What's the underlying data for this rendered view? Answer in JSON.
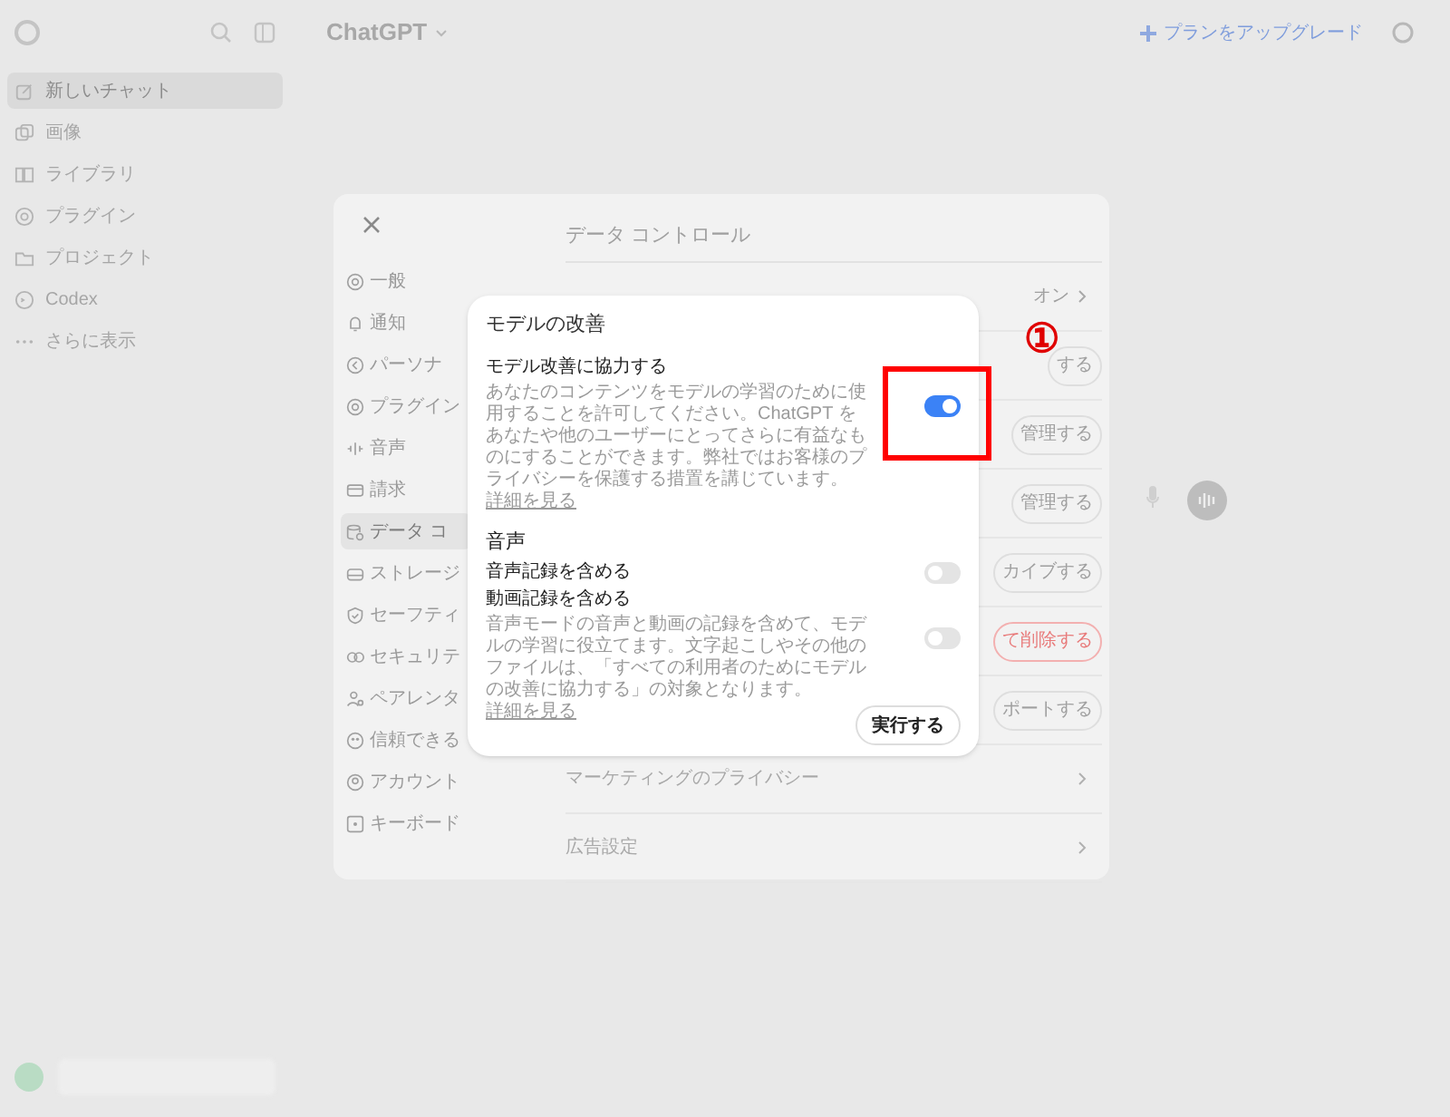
{
  "topbar": {
    "title": "ChatGPT",
    "upgrade": "プランをアップグレード"
  },
  "sidebar": {
    "items": [
      {
        "label": "新しいチャット",
        "selected": true
      },
      {
        "label": "画像",
        "selected": false
      },
      {
        "label": "ライブラリ",
        "selected": false
      },
      {
        "label": "プラグイン",
        "selected": false
      },
      {
        "label": "プロジェクト",
        "selected": false
      },
      {
        "label": "Codex",
        "selected": false
      },
      {
        "label": "さらに表示",
        "selected": false
      }
    ]
  },
  "settings": {
    "nav": [
      {
        "label": "一般",
        "selected": false
      },
      {
        "label": "通知",
        "selected": false
      },
      {
        "label": "パーソナ",
        "selected": false
      },
      {
        "label": "プラグイン",
        "selected": false
      },
      {
        "label": "音声",
        "selected": false
      },
      {
        "label": "請求",
        "selected": false
      },
      {
        "label": "データ コ",
        "selected": true
      },
      {
        "label": "ストレージ",
        "selected": false
      },
      {
        "label": "セーフティ",
        "selected": false
      },
      {
        "label": "セキュリテ",
        "selected": false
      },
      {
        "label": "ペアレンタ",
        "selected": false
      },
      {
        "label": "信頼できる",
        "selected": false
      },
      {
        "label": "アカウント",
        "selected": false
      },
      {
        "label": "キーボード",
        "selected": false
      }
    ],
    "title": "データ コントロール",
    "rows": [
      {
        "kind": "value",
        "value": "オン"
      },
      {
        "kind": "button",
        "action": "する",
        "danger": false
      },
      {
        "kind": "button",
        "action": "管理する",
        "danger": false
      },
      {
        "kind": "button",
        "action": "管理する",
        "danger": false
      },
      {
        "kind": "button",
        "action": "カイブする",
        "danger": false
      },
      {
        "kind": "button",
        "action": "て削除する",
        "danger": true
      },
      {
        "kind": "button",
        "action": "ポートする",
        "danger": false
      },
      {
        "kind": "link",
        "label": "マーケティングのプライバシー"
      },
      {
        "kind": "link",
        "label": "広告設定"
      }
    ]
  },
  "dialog": {
    "title": "モデルの改善",
    "options": [
      {
        "kind": "toggle",
        "label": "モデル改善に協力する",
        "description": "あなたのコンテンツをモデルの学習のために使用することを許可してください。ChatGPT をあなたや他のユーザーにとってさらに有益なものにすることができます。弊社ではお客様のプライバシーを保護する措置を講じています。",
        "link": "詳細を見る",
        "on": true
      },
      {
        "kind": "heading",
        "label": "音声"
      },
      {
        "kind": "toggle",
        "label": "音声記録を含める",
        "on": false
      },
      {
        "kind": "toggle",
        "label": "動画記録を含める",
        "description": "音声モードの音声と動画の記録を含めて、モデルの学習に役立てます。文字起こしやその他のファイルは、「すべての利用者のためにモデルの改善に協力する」の対象となります。",
        "link": "詳細を見る",
        "on": false
      }
    ],
    "button": "実行する"
  },
  "annotation": {
    "number": "①"
  }
}
